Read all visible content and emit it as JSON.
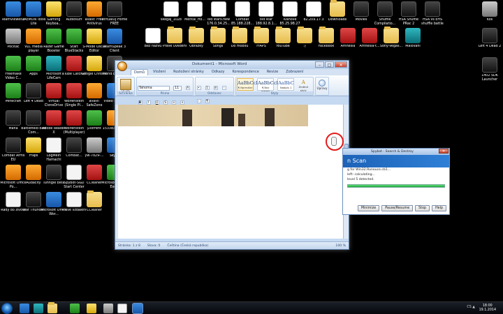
{
  "desktop": {
    "left_icons": [
      {
        "label": "TeamViewer 8",
        "style": "blue"
      },
      {
        "label": "DAEMON Tools Lite",
        "style": "blue"
      },
      {
        "label": "Gaming Keyboa...",
        "style": "yellow"
      },
      {
        "label": "Audiosurf",
        "style": "dark"
      },
      {
        "label": "avast! Free Antivirus",
        "style": "orange"
      },
      {
        "label": "VirtualDJ Home FREE",
        "style": "dark"
      },
      {
        "label": "Počítač",
        "style": "gray"
      },
      {
        "label": "VLC media player",
        "style": "orange"
      },
      {
        "label": "Razer Game Booster",
        "style": "green"
      },
      {
        "label": "Start BlueStacks",
        "style": "green"
      },
      {
        "label": "S-Mode Oscar Editor",
        "style": "yellow"
      },
      {
        "label": "TeamSpeak 3 Client",
        "style": "blue"
      },
      {
        "label": "Freemake Video C...",
        "style": "green"
      },
      {
        "label": "Apps",
        "style": "green"
      },
      {
        "label": "Microsoft LifeCam",
        "style": "teal"
      },
      {
        "label": "aTube Catcher",
        "style": "red"
      },
      {
        "label": "Google Chrome",
        "style": "yellow"
      },
      {
        "label": "World of Tanks",
        "style": "dark"
      },
      {
        "label": "Minecraft",
        "style": "green"
      },
      {
        "label": "Left 4 Dead",
        "style": "dark"
      },
      {
        "label": "Virtual CloneDrive",
        "style": "red"
      },
      {
        "label": "Wolfenstein (Single Pl...",
        "style": "red"
      },
      {
        "label": "avast! SafeZone",
        "style": "orange"
      },
      {
        "label": "Video Search",
        "style": "blue"
      },
      {
        "label": "Mafia",
        "style": "dark"
      },
      {
        "label": "Battlefield Bad Com...",
        "style": "dark"
      },
      {
        "label": "Adobe Reader X",
        "style": "red"
      },
      {
        "label": "Wolfenstein (Multiplayer)",
        "style": "red"
      },
      {
        "label": "µTorrent",
        "style": "green"
      },
      {
        "label": "1533836_50...",
        "style": "orange"
      },
      {
        "label": "Combat Arms EU",
        "style": "dark"
      },
      {
        "label": "Fraps",
        "style": "yellow"
      },
      {
        "label": "LogMeIn Hamachi",
        "style": "white"
      },
      {
        "label": "Combat...",
        "style": "dark"
      },
      {
        "label": "yw-7o29-...",
        "style": "gray"
      },
      {
        "label": "Skype",
        "style": "blue"
      },
      {
        "label": "Microsoft Office Po...",
        "style": "orange"
      },
      {
        "label": "Audacity",
        "style": "orange"
      },
      {
        "label": "Tunngle beta",
        "style": "dark"
      },
      {
        "label": "Spybot-S&D Start Center",
        "style": "white"
      },
      {
        "label": "CCleaner",
        "style": "red"
      },
      {
        "label": "Microsoft Office Exc...",
        "style": "green"
      },
      {
        "label": "Rady do života",
        "style": "white"
      },
      {
        "label": "War Thunder",
        "style": "dark"
      },
      {
        "label": "Microsoft Office Wor...",
        "style": "blue"
      },
      {
        "label": "Právě vzdálení",
        "style": "white"
      },
      {
        "label": "CCleaner",
        "style": "folder"
      }
    ],
    "top_icons": [
      {
        "label": "skegaj_1028",
        "style": "doc"
      },
      {
        "label": "Mental_Ho...",
        "style": "doc"
      },
      {
        "label": "old stars.new 176.0.34.25...",
        "style": "doc"
      },
      {
        "label": "Combat 85.188.228...",
        "style": "doc"
      },
      {
        "label": "old star 188.92.8.1...",
        "style": "doc"
      },
      {
        "label": "Ivanové 85.25.98.27",
        "style": "doc"
      },
      {
        "label": "82.209.17.3",
        "style": "doc"
      },
      {
        "label": "Downloads",
        "style": "folder"
      },
      {
        "label": "Movies",
        "style": "dark"
      },
      {
        "label": "Shuffle Compilatio...",
        "style": "dark"
      },
      {
        "label": "HSA Shuffle PRac 2",
        "style": "dark"
      },
      {
        "label": "HSA vs EHS shuffle battle",
        "style": "dark"
      },
      {
        "label": "Koš",
        "style": "gray"
      },
      {
        "label": "Bez názvu",
        "style": "doc"
      },
      {
        "label": "Právě uvedeni",
        "style": "folder"
      },
      {
        "label": "Obrázky",
        "style": "folder"
      },
      {
        "label": "Songs",
        "style": "folder"
      },
      {
        "label": "Do mobilu",
        "style": "folder"
      },
      {
        "label": "FrAPS",
        "style": "folder"
      },
      {
        "label": "YouTube",
        "style": "folder"
      },
      {
        "label": ":)",
        "style": "folder"
      },
      {
        "label": "Facebook",
        "style": "folder"
      },
      {
        "label": "Amnesia",
        "style": "red"
      },
      {
        "label": "Amnesia-t...",
        "style": "red"
      },
      {
        "label": "Sony-Vegas...",
        "style": "folder"
      },
      {
        "label": "Malování",
        "style": "teal"
      },
      {
        "label": "Left 4 Dead 2",
        "style": "dark"
      },
      {
        "label": "1402 SDK Launcher",
        "style": "dark"
      }
    ]
  },
  "word": {
    "title": "Dokument1 - Microsoft Word",
    "tabs": [
      "Domů",
      "Vložení",
      "Rozložení stránky",
      "Odkazy",
      "Korespondence",
      "Revize",
      "Zobrazení"
    ],
    "groups": [
      "Schránka",
      "Písmo",
      "Odstavec",
      "Styly",
      "Úpravy"
    ],
    "paste_label": "Vložit",
    "font_name": "Tahoma",
    "font_size": "11",
    "styles": [
      {
        "preview": "AaBbCcDc",
        "name": "¶ Normální"
      },
      {
        "preview": "AaBbCcDc",
        "name": "¶ Bez mezer"
      },
      {
        "preview": "AaBbC",
        "name": "Nadpis 1"
      }
    ],
    "change_styles": "Změnit styly",
    "edit_label": "Úpravy",
    "status": {
      "page": "Stránka: 1 z 8",
      "words": "Slova: 0",
      "lang": "Čeština (Česká republika)",
      "zoom": "100 %"
    }
  },
  "scan": {
    "title": "Spybot - Search & Destroy",
    "header": "n Scan",
    "lines": [
      "g for Win32.Runouce.cb1...",
      "left: calculating...",
      "",
      "level 5 detected."
    ],
    "progress": 1.0,
    "buttons": [
      "Minimize",
      "Pause/Resume",
      "Stop",
      "Help"
    ]
  },
  "taskbar": {
    "clock_time": "18:00",
    "clock_date": "19.1.2014",
    "tray": "CS ▲",
    "apps": [
      "ie",
      "skype",
      "explorer",
      "utorrent",
      "chrome",
      "rdp",
      "display",
      "word"
    ]
  }
}
